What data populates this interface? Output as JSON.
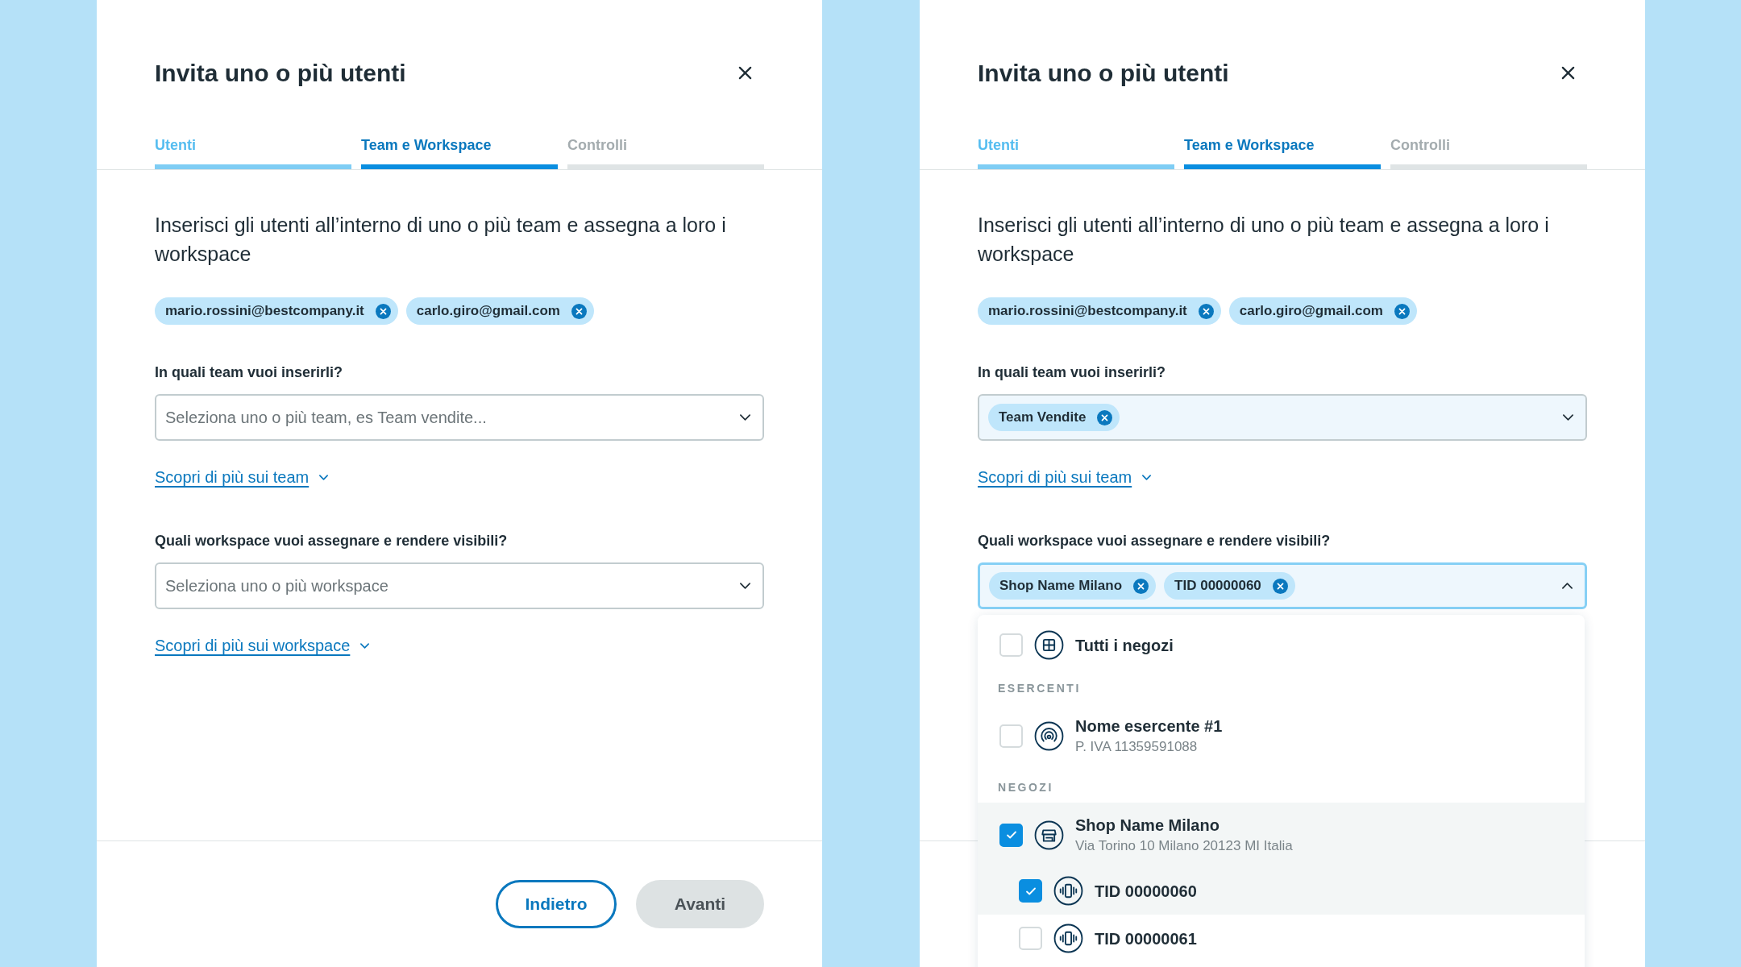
{
  "dialogs": [
    {
      "title": "Invita uno o più utenti",
      "tabs": [
        {
          "label": "Utenti",
          "selected": false,
          "completed": true
        },
        {
          "label": "Team e Workspace",
          "selected": true,
          "completed": false
        },
        {
          "label": "Controlli",
          "selected": false,
          "completed": false
        }
      ],
      "description": "Inserisci gli utenti all’interno di uno o più team e assegna a loro i workspace",
      "recipients": [
        "mario.rossini@bestcompany.it",
        "carlo.giro@gmail.com"
      ],
      "team_field": {
        "label": "In quali team vuoi inserirli?",
        "placeholder": "Seleziona uno o più team, es Team vendite...",
        "expanded": false
      },
      "team_link": "Scopri di più sui team",
      "workspace_field": {
        "label": "Quali workspace vuoi assegnare e rendere visibili?",
        "placeholder": "Seleziona uno o più workspace",
        "expanded": false
      },
      "workspace_link": "Scopri di più sui workspace",
      "buttons": [
        {
          "label": "Indietro",
          "kind": "outline"
        },
        {
          "label": "Avanti",
          "kind": "disabled"
        }
      ]
    },
    {
      "title": "Invita uno o più utenti",
      "tabs": [
        {
          "label": "Utenti",
          "selected": false,
          "completed": true
        },
        {
          "label": "Team e Workspace",
          "selected": true,
          "completed": false
        },
        {
          "label": "Controlli",
          "selected": false,
          "completed": false
        }
      ],
      "description": "Inserisci gli utenti all’interno di uno o più team e assegna a loro i workspace",
      "recipients": [
        "mario.rossini@bestcompany.it",
        "carlo.giro@gmail.com"
      ],
      "team_field": {
        "label": "In quali team vuoi inserirli?",
        "chips": [
          "Team Vendite"
        ],
        "expanded": false
      },
      "team_link": "Scopri di più sui team",
      "workspace_field": {
        "label": "Quali workspace vuoi assegnare e rendere visibili?",
        "chips": [
          "Shop Name Milano",
          "TID 00000060"
        ],
        "expanded": true,
        "options": [
          {
            "kind": "all",
            "label": "Tutti i negozi",
            "checked": false,
            "highlighted": false
          },
          {
            "kind": "header",
            "label": "ESERCENTI"
          },
          {
            "kind": "merchant",
            "label": "Nome esercente #1",
            "subtitle": "P. IVA 11359591088",
            "checked": false,
            "highlighted": false
          },
          {
            "kind": "header",
            "label": "NEGOZI"
          },
          {
            "kind": "store",
            "label": "Shop Name Milano",
            "subtitle": "Via Torino 10 Milano 20123 MI Italia",
            "checked": true,
            "highlighted": true,
            "children": [
              {
                "kind": "terminal",
                "label": "TID 00000060",
                "checked": true,
                "highlighted": true
              },
              {
                "kind": "terminal",
                "label": "TID 00000061",
                "checked": false,
                "highlighted": false
              }
            ]
          }
        ]
      }
    }
  ]
}
